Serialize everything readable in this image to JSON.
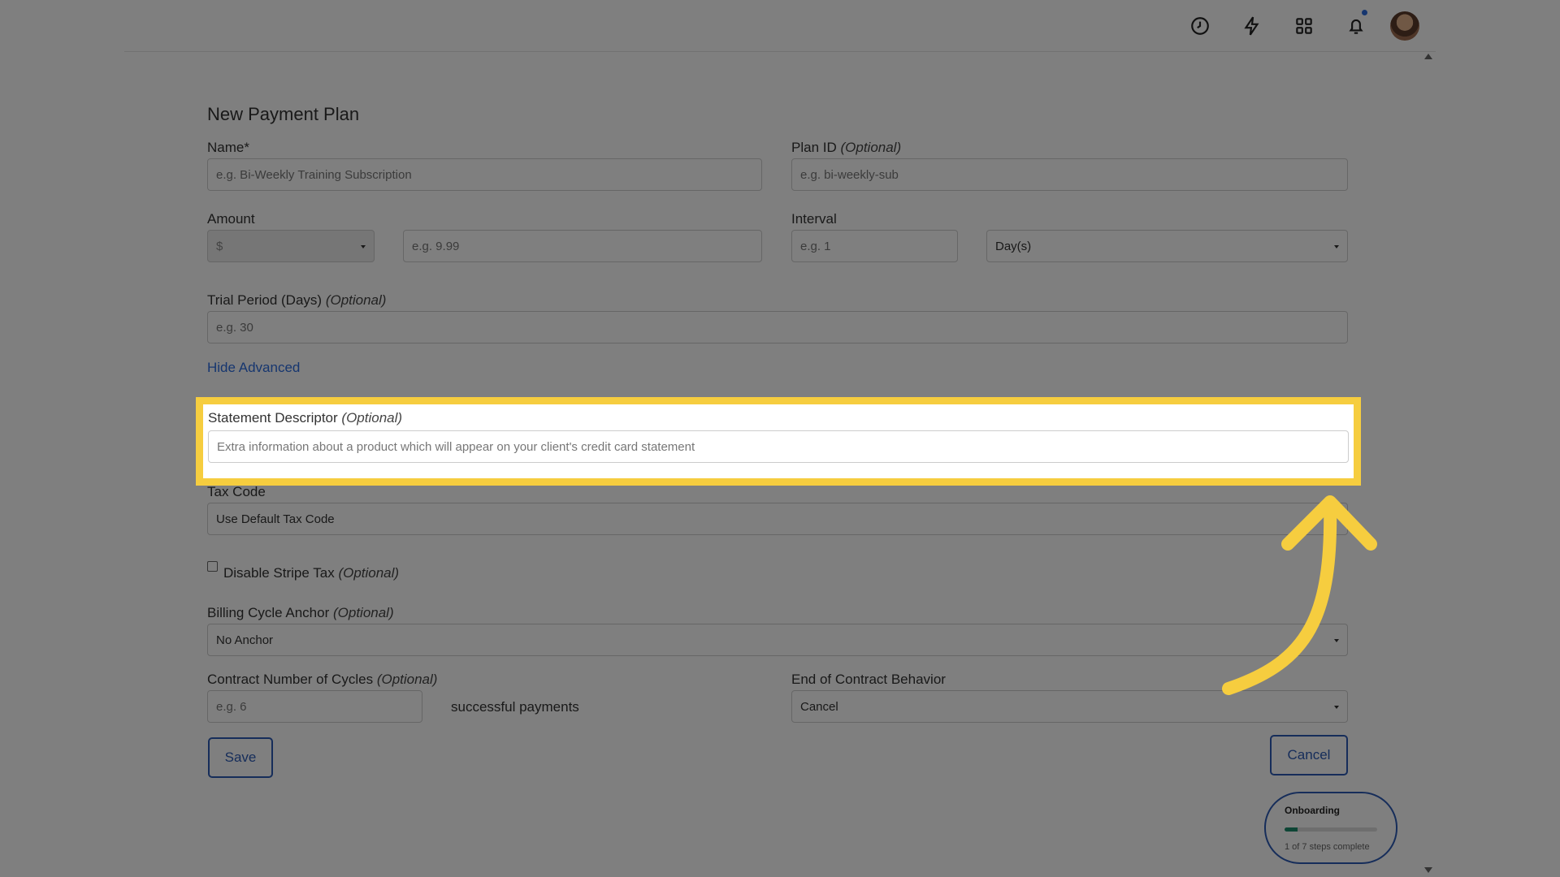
{
  "topbar": {
    "icons": [
      "clock-icon",
      "lightning-icon",
      "apps-grid-icon",
      "bell-icon"
    ],
    "notification_dot_color": "#2d6cdf"
  },
  "form": {
    "title": "New Payment Plan",
    "name": {
      "label": "Name*",
      "placeholder": "e.g. Bi-Weekly Training Subscription"
    },
    "plan_id": {
      "label": "Plan ID",
      "optional": "(Optional)",
      "placeholder": "e.g. bi-weekly-sub"
    },
    "amount": {
      "label": "Amount",
      "currency": "$",
      "placeholder": "e.g. 9.99"
    },
    "interval": {
      "label": "Interval",
      "placeholder": "e.g. 1",
      "unit": "Day(s)"
    },
    "trial": {
      "label": "Trial Period (Days)",
      "optional": "(Optional)",
      "placeholder": "e.g. 30"
    },
    "hide_advanced": "Hide Advanced",
    "statement": {
      "label": "Statement Descriptor",
      "optional": "(Optional)",
      "placeholder": "Extra information about a product which will appear on your client's credit card statement"
    },
    "tax_code": {
      "label": "Tax Code",
      "value": "Use Default Tax Code"
    },
    "disable_tax": {
      "label": "Disable Stripe Tax",
      "optional": "(Optional)"
    },
    "billing_anchor": {
      "label": "Billing Cycle Anchor",
      "optional": "(Optional)",
      "value": "No Anchor"
    },
    "contract_cycles": {
      "label": "Contract Number of Cycles",
      "optional": "(Optional)",
      "placeholder": "e.g. 6",
      "suffix": "successful payments"
    },
    "end_behavior": {
      "label": "End of Contract Behavior",
      "value": "Cancel"
    },
    "save": "Save",
    "cancel": "Cancel"
  },
  "onboarding": {
    "title": "Onboarding",
    "status": "1 of 7 steps complete",
    "progress_fraction": 0.14
  },
  "annotation": {
    "highlight_color": "#f6cd3f"
  }
}
